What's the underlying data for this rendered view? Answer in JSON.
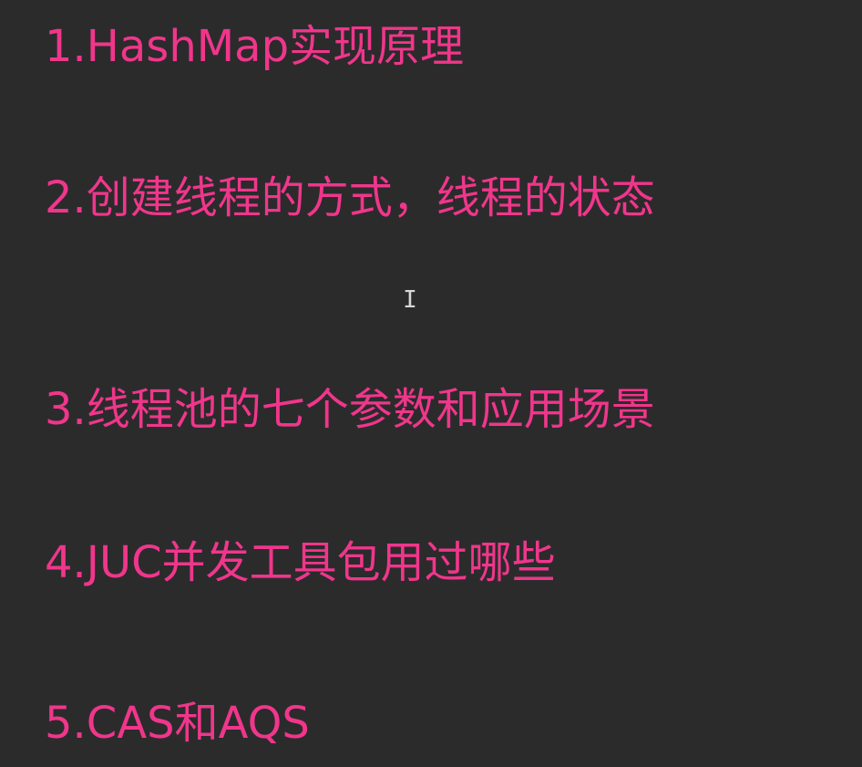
{
  "items": [
    {
      "text": "1.HashMap实现原理"
    },
    {
      "text": "2.创建线程的方式，线程的状态"
    },
    {
      "text": "3.线程池的七个参数和应用场景"
    },
    {
      "text": "4.JUC并发工具包用过哪些"
    },
    {
      "text": "5.CAS和AQS"
    }
  ],
  "cursor": {
    "glyph": "I"
  },
  "colors": {
    "background": "#2b2b2c",
    "text": "#f0368b"
  }
}
